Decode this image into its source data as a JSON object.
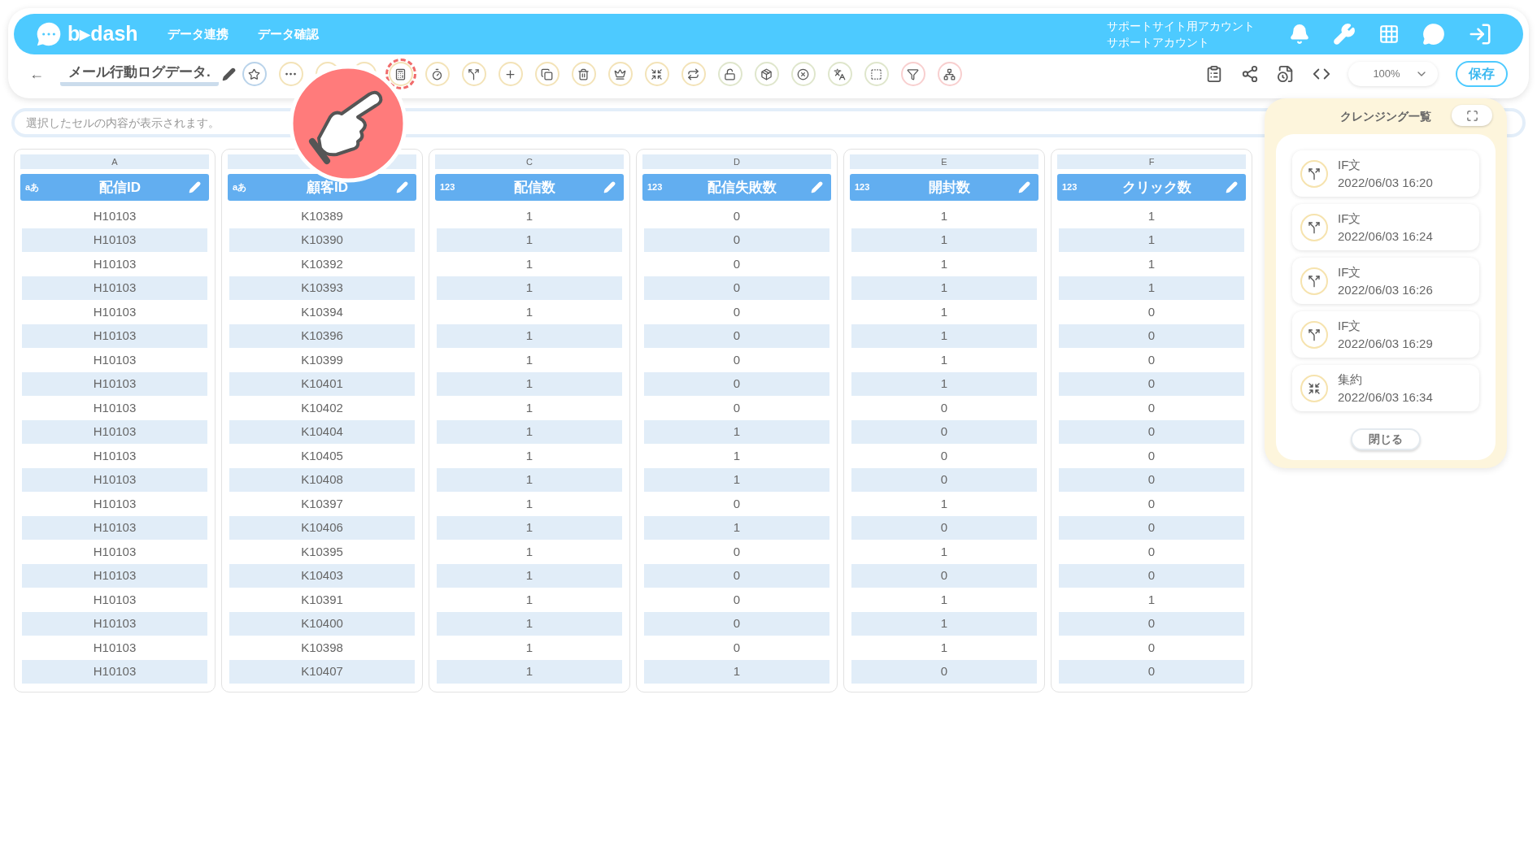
{
  "header": {
    "logo": "b▸dash",
    "nav": [
      "データ連携",
      "データ確認"
    ],
    "account": [
      "サポートサイト用アカウント",
      "サポートアカウント"
    ]
  },
  "toolbar": {
    "back": "←",
    "title": "メール行動ログデータ.",
    "tools": [
      {
        "kind": "star",
        "color": "#b9d3ea",
        "selected": false
      },
      {
        "kind": "dots",
        "color": "#f3e3b8",
        "selected": false
      },
      {
        "kind": "hidden",
        "color": "#f3e3b8",
        "selected": false
      },
      {
        "kind": "hidden",
        "color": "#f3e3b8",
        "selected": false
      },
      {
        "kind": "calc",
        "color": "#f3e3b8",
        "selected": true
      },
      {
        "kind": "timer",
        "color": "#f3e3b8",
        "selected": false
      },
      {
        "kind": "branch",
        "color": "#f3e3b8",
        "selected": false
      },
      {
        "kind": "plus",
        "color": "#f3e3b8",
        "selected": false
      },
      {
        "kind": "copy",
        "color": "#f3e3b8",
        "selected": false
      },
      {
        "kind": "trash",
        "color": "#f3e3b8",
        "selected": false
      },
      {
        "kind": "crown",
        "color": "#f3e3b8",
        "selected": false
      },
      {
        "kind": "shrink",
        "color": "#f3e3b8",
        "selected": false
      },
      {
        "kind": "repeat",
        "color": "#f3e3b8",
        "selected": false
      },
      {
        "kind": "lock",
        "color": "#dfe6cc",
        "selected": false
      },
      {
        "kind": "box",
        "color": "#dfe6cc",
        "selected": false
      },
      {
        "kind": "xcircle",
        "color": "#dfe6cc",
        "selected": false
      },
      {
        "kind": "translate",
        "color": "#dfe6cc",
        "selected": false
      },
      {
        "kind": "zero",
        "color": "#dfe6cc",
        "selected": false
      },
      {
        "kind": "filter",
        "color": "#f8cfcf",
        "selected": false
      },
      {
        "kind": "network",
        "color": "#f8cfcf",
        "selected": false
      }
    ],
    "zoom": "100%",
    "save": "保存"
  },
  "cell_bar": {
    "placeholder": "選択したセルの内容が表示されます。"
  },
  "table": {
    "columns": [
      {
        "letter": "A",
        "type": "aあ",
        "name": "配信ID",
        "values": [
          "H10103",
          "H10103",
          "H10103",
          "H10103",
          "H10103",
          "H10103",
          "H10103",
          "H10103",
          "H10103",
          "H10103",
          "H10103",
          "H10103",
          "H10103",
          "H10103",
          "H10103",
          "H10103",
          "H10103",
          "H10103",
          "H10103",
          "H10103"
        ]
      },
      {
        "type": "aあ",
        "name": "顧客ID",
        "values": [
          "K10389",
          "K10390",
          "K10392",
          "K10393",
          "K10394",
          "K10396",
          "K10399",
          "K10401",
          "K10402",
          "K10404",
          "K10405",
          "K10408",
          "K10397",
          "K10406",
          "K10395",
          "K10403",
          "K10391",
          "K10400",
          "K10398",
          "K10407"
        ]
      },
      {
        "letter": "C",
        "type": "123",
        "name": "配信数",
        "values": [
          "1",
          "1",
          "1",
          "1",
          "1",
          "1",
          "1",
          "1",
          "1",
          "1",
          "1",
          "1",
          "1",
          "1",
          "1",
          "1",
          "1",
          "1",
          "1",
          "1"
        ]
      },
      {
        "letter": "D",
        "type": "123",
        "name": "配信失敗数",
        "values": [
          "0",
          "0",
          "0",
          "0",
          "0",
          "0",
          "0",
          "0",
          "0",
          "1",
          "1",
          "1",
          "0",
          "1",
          "0",
          "0",
          "0",
          "0",
          "0",
          "1"
        ]
      },
      {
        "letter": "E",
        "type": "123",
        "name": "開封数",
        "values": [
          "1",
          "1",
          "1",
          "1",
          "1",
          "1",
          "1",
          "1",
          "0",
          "0",
          "0",
          "0",
          "1",
          "0",
          "1",
          "0",
          "1",
          "1",
          "1",
          "0"
        ]
      },
      {
        "letter": "F",
        "type": "123",
        "name": "クリック数",
        "values": [
          "1",
          "1",
          "1",
          "1",
          "0",
          "0",
          "0",
          "0",
          "0",
          "0",
          "0",
          "0",
          "0",
          "0",
          "0",
          "0",
          "1",
          "0",
          "0",
          "0"
        ]
      }
    ]
  },
  "cleansing_panel": {
    "title": "クレンジング一覧",
    "items": [
      {
        "kind": "if",
        "label": "IF文",
        "time": "2022/06/03 16:20"
      },
      {
        "kind": "if",
        "label": "IF文",
        "time": "2022/06/03 16:24"
      },
      {
        "kind": "if",
        "label": "IF文",
        "time": "2022/06/03 16:26"
      },
      {
        "kind": "if",
        "label": "IF文",
        "time": "2022/06/03 16:29"
      },
      {
        "kind": "aggregate",
        "label": "集約",
        "time": "2022/06/03 16:34"
      }
    ],
    "close": "閉じる"
  }
}
